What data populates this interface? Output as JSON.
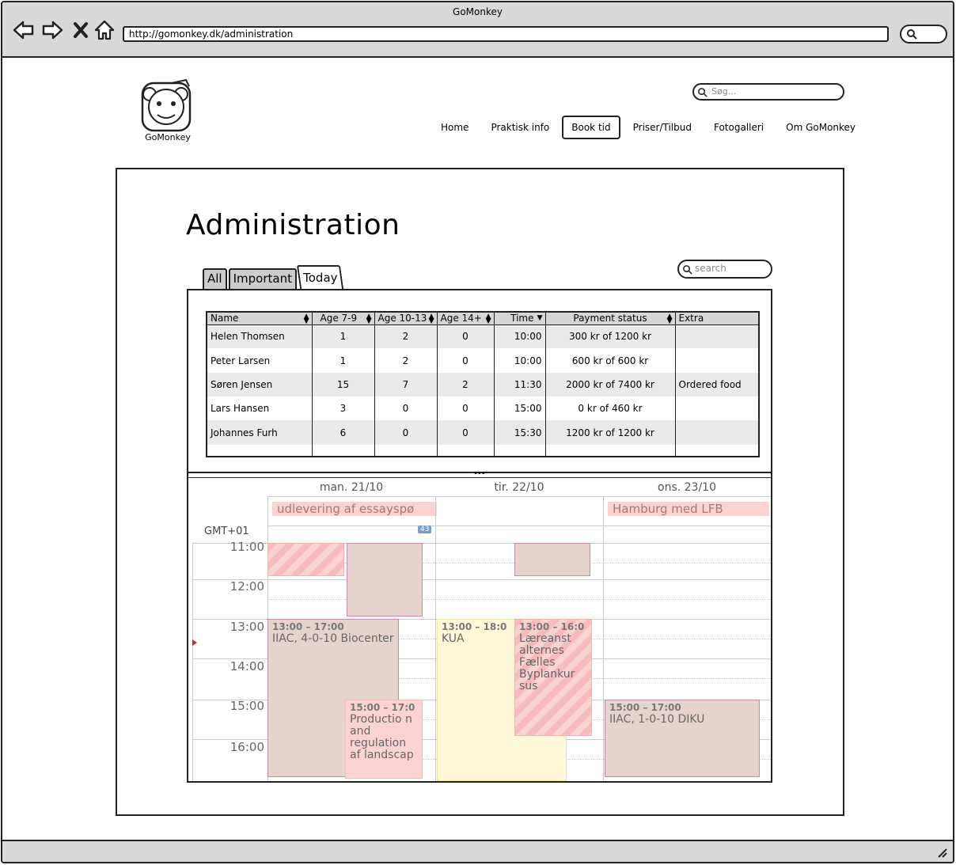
{
  "window": {
    "title": "GoMonkey",
    "url": "http://gomonkey.dk/administration"
  },
  "site": {
    "logo_label": "GoMonkey",
    "search_placeholder": "Søg...",
    "nav": [
      {
        "label": "Home",
        "active": false
      },
      {
        "label": "Praktisk info",
        "active": false
      },
      {
        "label": "Book tid",
        "active": true
      },
      {
        "label": "Priser/Tilbud",
        "active": false
      },
      {
        "label": "Fotogalleri",
        "active": false
      },
      {
        "label": "Om GoMonkey",
        "active": false
      }
    ]
  },
  "page": {
    "title": "Administration",
    "tabs": [
      "All",
      "Important",
      "Today"
    ],
    "active_tab": "Today",
    "search_placeholder": "search"
  },
  "table": {
    "columns": [
      "Name",
      "Age 7-9",
      "Age 10-13",
      "Age 14+",
      "Time",
      "Payment status",
      "Extra"
    ],
    "rows": [
      [
        "Helen Thomsen",
        "1",
        "2",
        "0",
        "10:00",
        "300 kr of 1200 kr",
        ""
      ],
      [
        "Peter Larsen",
        "1",
        "2",
        "0",
        "10:00",
        "600 kr of 600 kr",
        ""
      ],
      [
        "Søren Jensen",
        "15",
        "7",
        "2",
        "11:30",
        "2000 kr of 7400 kr",
        "Ordered food"
      ],
      [
        "Lars Hansen",
        "3",
        "0",
        "0",
        "15:00",
        "0 kr of 460 kr",
        ""
      ],
      [
        "Johannes Furh",
        "6",
        "0",
        "0",
        "15:30",
        "1200 kr of 1200 kr",
        ""
      ]
    ]
  },
  "calendar": {
    "timezone": "GMT+01",
    "week_badge": "43",
    "days": [
      "man. 21/10",
      "tir. 22/10",
      "ons. 23/10"
    ],
    "allday_events": [
      "udlevering af essayspø",
      "Hamburg med LFB"
    ],
    "hours": [
      "11:00",
      "12:00",
      "13:00",
      "14:00",
      "15:00",
      "16:00"
    ],
    "events": [
      {
        "time": "13:00 – 17:00",
        "title": "IIAC, 4-0-10 Biocenter"
      },
      {
        "time": "15:00 – 17:0",
        "title": "Productio n and regulation af landscap"
      },
      {
        "time": "13:00 – 18:0",
        "title": "KUA"
      },
      {
        "time": "13:00 – 16:0",
        "title": "Læreanst alternes Fælles Byplankur sus"
      },
      {
        "time": "15:00 – 17:00",
        "title": "IIAC, 1-0-10 DIKU"
      }
    ]
  }
}
